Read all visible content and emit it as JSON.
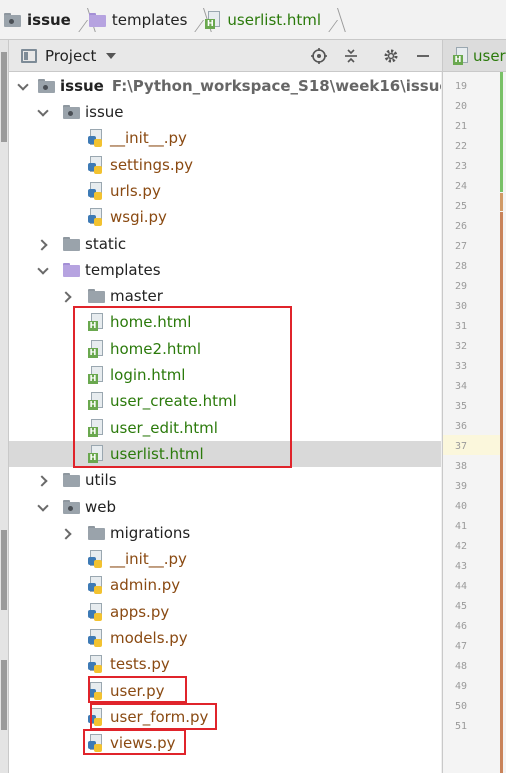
{
  "breadcrumb": {
    "items": [
      {
        "label": "issue",
        "icon": "folder-icon"
      },
      {
        "label": "templates",
        "icon": "folder-purple-icon"
      },
      {
        "label": "userlist.html",
        "icon": "html-file-icon"
      }
    ]
  },
  "panel": {
    "title": "Project",
    "buttons": [
      "locate-icon",
      "collapse-all-icon",
      "gear-icon",
      "minimize-icon"
    ]
  },
  "tree": {
    "root": {
      "label": "issue",
      "path": "F:\\Python_workspace_S18\\week16\\issue"
    },
    "rows": [
      {
        "label": "issue",
        "type": "folder",
        "depth": 1,
        "expanded": true
      },
      {
        "label": "__init__.py",
        "type": "py",
        "depth": 2
      },
      {
        "label": "settings.py",
        "type": "py",
        "depth": 2
      },
      {
        "label": "urls.py",
        "type": "py",
        "depth": 2
      },
      {
        "label": "wsgi.py",
        "type": "py",
        "depth": 2
      },
      {
        "label": "static",
        "type": "folder",
        "depth": 1,
        "expanded": false
      },
      {
        "label": "templates",
        "type": "folder-purple",
        "depth": 1,
        "expanded": true
      },
      {
        "label": "master",
        "type": "folder",
        "depth": 2,
        "expanded": false
      },
      {
        "label": "home.html",
        "type": "html",
        "depth": 2
      },
      {
        "label": "home2.html",
        "type": "html",
        "depth": 2
      },
      {
        "label": "login.html",
        "type": "html",
        "depth": 2
      },
      {
        "label": "user_create.html",
        "type": "html",
        "depth": 2
      },
      {
        "label": "user_edit.html",
        "type": "html",
        "depth": 2
      },
      {
        "label": "userlist.html",
        "type": "html",
        "depth": 2,
        "selected": true
      },
      {
        "label": "utils",
        "type": "folder",
        "depth": 1,
        "expanded": false
      },
      {
        "label": "web",
        "type": "folder",
        "depth": 1,
        "expanded": true
      },
      {
        "label": "migrations",
        "type": "folder",
        "depth": 2,
        "expanded": false
      },
      {
        "label": "__init__.py",
        "type": "py",
        "depth": 2
      },
      {
        "label": "admin.py",
        "type": "py",
        "depth": 2
      },
      {
        "label": "apps.py",
        "type": "py",
        "depth": 2
      },
      {
        "label": "models.py",
        "type": "py",
        "depth": 2
      },
      {
        "label": "tests.py",
        "type": "py",
        "depth": 2
      },
      {
        "label": "user.py",
        "type": "py",
        "depth": 2
      },
      {
        "label": "user_form.py",
        "type": "py",
        "depth": 2
      },
      {
        "label": "views.py",
        "type": "py",
        "depth": 2
      }
    ]
  },
  "editor": {
    "tab_label": "user",
    "line_numbers": [
      "19",
      "20",
      "21",
      "22",
      "23",
      "24",
      "25",
      "26",
      "27",
      "28",
      "29",
      "30",
      "31",
      "32",
      "33",
      "34",
      "35",
      "36",
      "37",
      "38",
      "39",
      "40",
      "41",
      "42",
      "43",
      "44",
      "45",
      "46",
      "47",
      "48",
      "49",
      "50",
      "51"
    ],
    "current_line": "37"
  },
  "colors": {
    "highlight_box": "#e0242b",
    "py_file_text": "#8a4a12",
    "html_file_text": "#2b7a0b",
    "selected_row": "#d9d9d9"
  }
}
